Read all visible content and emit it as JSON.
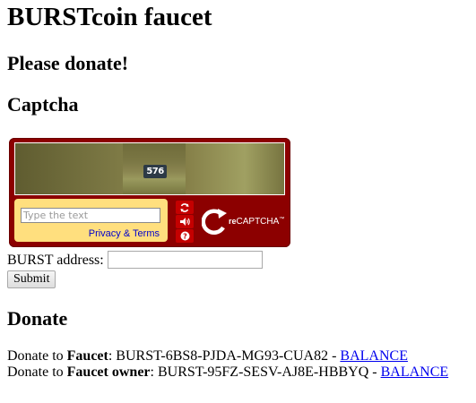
{
  "page": {
    "title": "BURSTcoin faucet",
    "subtitle": "Please donate!",
    "captcha_heading": "Captcha",
    "donate_heading": "Donate"
  },
  "captcha": {
    "image_text": "576",
    "input_placeholder": "Type the text",
    "privacy_link": "Privacy & Terms",
    "logo_prefix": "re",
    "logo_text": "CAPTCHA",
    "logo_tm": "™",
    "buttons": [
      "refresh-icon",
      "audio-icon",
      "help-icon"
    ],
    "colors": {
      "frame": "#8c0000",
      "input_box": "#ffdf7e",
      "button": "#c40000"
    }
  },
  "form": {
    "address_label": "BURST address:",
    "address_value": "",
    "submit_label": "Submit"
  },
  "donate": {
    "lines": [
      {
        "prefix": "Donate to ",
        "who": "Faucet",
        "address": ": BURST-6BS8-PJDA-MG93-CUA82 - ",
        "link": "BALANCE"
      },
      {
        "prefix": "Donate to ",
        "who": "Faucet owner",
        "address": ": BURST-95FZ-SESV-AJ8E-HBBYQ - ",
        "link": "BALANCE"
      }
    ]
  }
}
